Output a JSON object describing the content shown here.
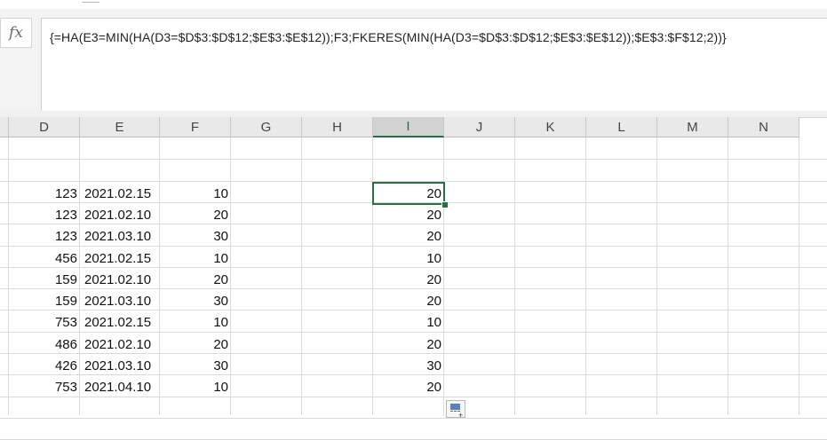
{
  "formula_bar": {
    "fx_label": "fx",
    "formula": "{=HA(E3=MIN(HA(D3=$D$3:$D$12;$E$3:$E$12));F3;FKERES(MIN(HA(D3=$D$3:$D$12;$E$3:$E$12));$E$3:$F$12;2))}"
  },
  "columns": [
    "D",
    "E",
    "F",
    "G",
    "H",
    "I",
    "J",
    "K",
    "L",
    "M",
    "N"
  ],
  "active_column": "I",
  "rows": [
    {
      "d": "123",
      "e": "2021.02.15",
      "f": "10",
      "i": "20"
    },
    {
      "d": "123",
      "e": "2021.02.10",
      "f": "20",
      "i": "20"
    },
    {
      "d": "123",
      "e": "2021.03.10",
      "f": "30",
      "i": "20"
    },
    {
      "d": "456",
      "e": "2021.02.15",
      "f": "10",
      "i": "10"
    },
    {
      "d": "159",
      "e": "2021.02.10",
      "f": "20",
      "i": "20"
    },
    {
      "d": "159",
      "e": "2021.03.10",
      "f": "30",
      "i": "20"
    },
    {
      "d": "753",
      "e": "2021.02.15",
      "f": "10",
      "i": "10"
    },
    {
      "d": "486",
      "e": "2021.02.10",
      "f": "20",
      "i": "20"
    },
    {
      "d": "426",
      "e": "2021.03.10",
      "f": "30",
      "i": "30"
    },
    {
      "d": "753",
      "e": "2021.04.10",
      "f": "10",
      "i": "20"
    }
  ],
  "colors": {
    "accent": "#217346",
    "header_bg": "#e9e9e9",
    "grid": "#dadada"
  },
  "icons": {
    "fx": "function-icon",
    "quick_analysis": "quick-analysis-icon"
  }
}
